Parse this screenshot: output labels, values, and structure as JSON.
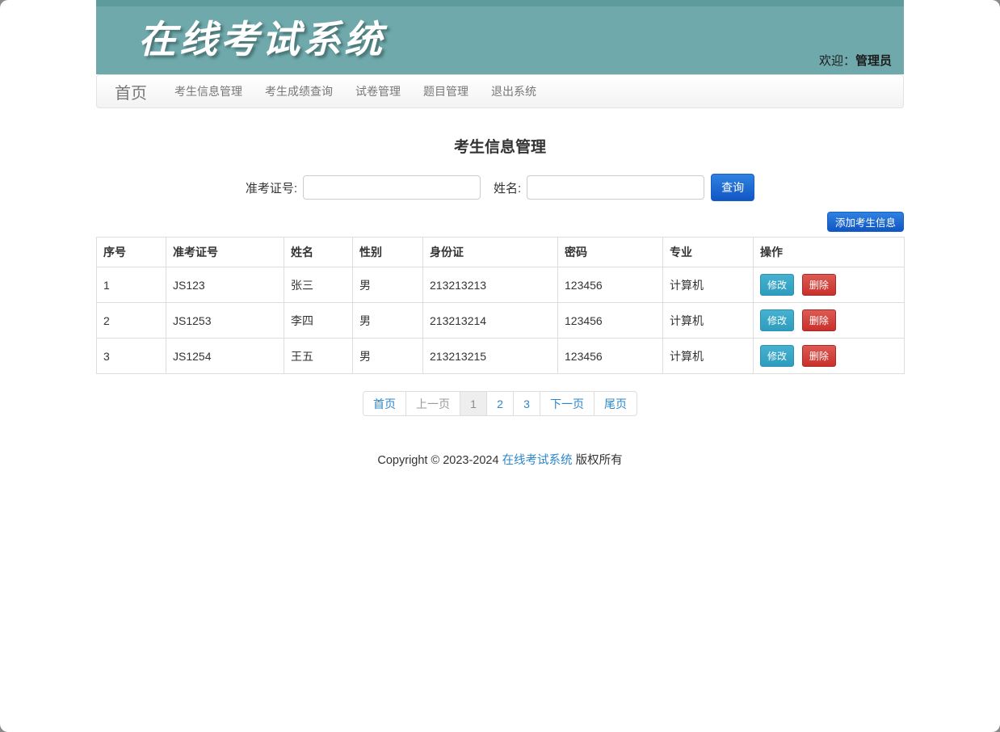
{
  "header": {
    "brand_title": "在线考试系统",
    "welcome_label": "欢迎：",
    "username": "管理员"
  },
  "nav": {
    "brand": "首页",
    "items": [
      {
        "label": "考生信息管理"
      },
      {
        "label": "考生成绩查询"
      },
      {
        "label": "试卷管理"
      },
      {
        "label": "题目管理"
      },
      {
        "label": "退出系统"
      }
    ]
  },
  "main": {
    "page_title": "考生信息管理",
    "search": {
      "ticket_label": "准考证号:",
      "ticket_value": "",
      "name_label": "姓名:",
      "name_value": "",
      "query_button": "查询"
    },
    "add_button": "添加考生信息",
    "table": {
      "headers": [
        "序号",
        "准考证号",
        "姓名",
        "性别",
        "身份证",
        "密码",
        "专业",
        "操作"
      ],
      "edit_label": "修改",
      "delete_label": "删除",
      "rows": [
        {
          "index": "1",
          "ticket": "JS123",
          "name": "张三",
          "gender": "男",
          "id_card": "213213213",
          "password": "123456",
          "major": "计算机"
        },
        {
          "index": "2",
          "ticket": "JS1253",
          "name": "李四",
          "gender": "男",
          "id_card": "213213214",
          "password": "123456",
          "major": "计算机"
        },
        {
          "index": "3",
          "ticket": "JS1254",
          "name": "王五",
          "gender": "男",
          "id_card": "213213215",
          "password": "123456",
          "major": "计算机"
        }
      ]
    },
    "pagination": {
      "first": "首页",
      "prev": "上一页",
      "pages": [
        "1",
        "2",
        "3"
      ],
      "active_page": "1",
      "next": "下一页",
      "last": "尾页"
    },
    "footer": {
      "copyright_prefix": "Copyright © 2023-2024 ",
      "site_link": "在线考试系统",
      "copyright_suffix": " 版权所有"
    }
  },
  "colors": {
    "banner_bg": "#6FA9AB",
    "banner_top_strip": "#5E9B9D",
    "primary_button": "#1F6FD4",
    "edit_button": "#3AA7C8",
    "delete_button": "#D9534F",
    "link_blue": "#2D87CA",
    "table_border": "#DDDDDD",
    "navbar_bg": "#F6F6F6"
  }
}
